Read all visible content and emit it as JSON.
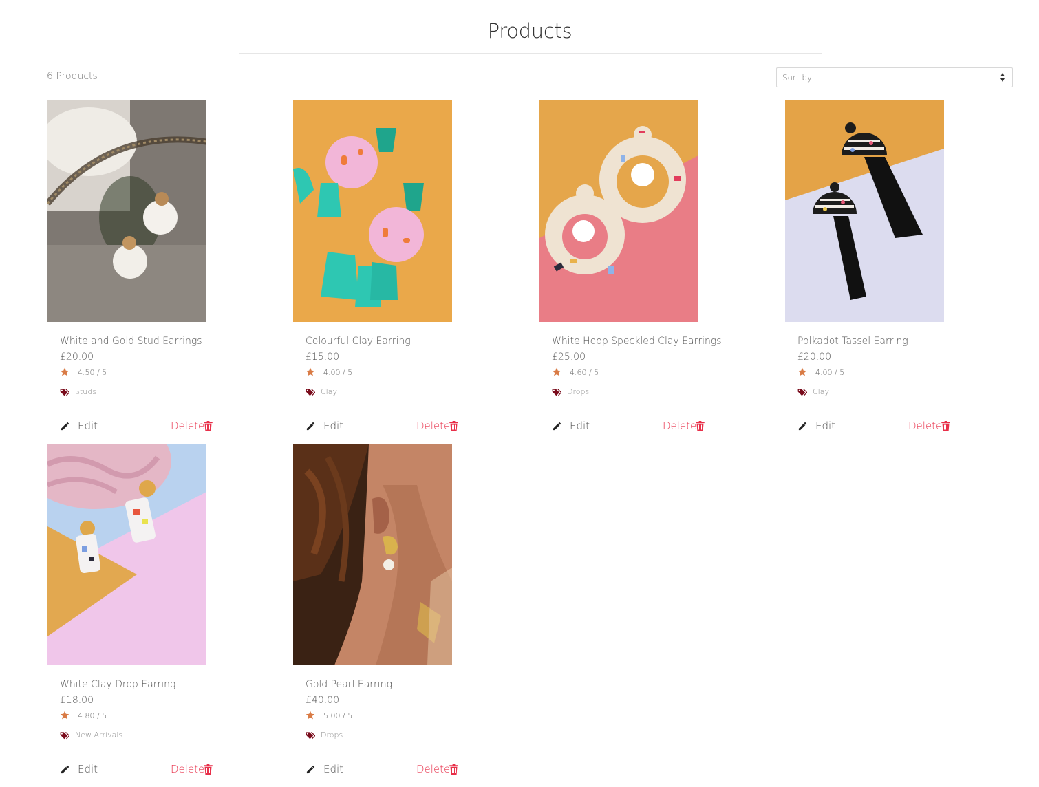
{
  "page": {
    "title": "Products",
    "count_label": "6 Products",
    "sort_placeholder": "Sort by..."
  },
  "colors": {
    "accent_delete": "#e8304a",
    "star": "#d97b45",
    "tag": "#7a0c1c"
  },
  "products": [
    {
      "name": "White and Gold Stud Earrings",
      "price": "£20.00",
      "rating": "4.50 / 5",
      "category": "Studs",
      "image": "white-gold-stud-earrings-photo",
      "edit_label": "Edit",
      "delete_label": "Delete"
    },
    {
      "name": "Colourful Clay Earring",
      "price": "£15.00",
      "rating": "4.00 / 5",
      "category": "Clay",
      "image": "colourful-clay-earring-photo",
      "edit_label": "Edit",
      "delete_label": "Delete"
    },
    {
      "name": "White Hoop Speckled Clay Earrings",
      "price": "£25.00",
      "rating": "4.60 / 5",
      "category": "Drops",
      "image": "white-hoop-speckled-earrings-photo",
      "edit_label": "Edit",
      "delete_label": "Delete"
    },
    {
      "name": "Polkadot Tassel Earring",
      "price": "£20.00",
      "rating": "4.00 / 5",
      "category": "Clay",
      "image": "polkadot-tassel-earring-photo",
      "edit_label": "Edit",
      "delete_label": "Delete"
    },
    {
      "name": "White Clay Drop Earring",
      "price": "£18.00",
      "rating": "4.80 / 5",
      "category": "New Arrivals",
      "image": "white-clay-drop-earring-photo",
      "edit_label": "Edit",
      "delete_label": "Delete"
    },
    {
      "name": "Gold Pearl Earring",
      "price": "£40.00",
      "rating": "5.00 / 5",
      "category": "Drops",
      "image": "gold-pearl-earring-photo",
      "edit_label": "Edit",
      "delete_label": "Delete"
    }
  ]
}
